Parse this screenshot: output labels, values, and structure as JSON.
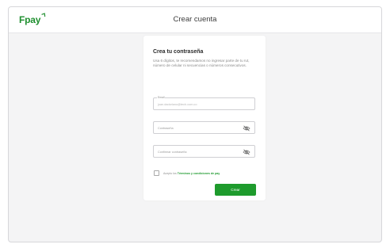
{
  "header": {
    "logo_text": "Fpay",
    "title": "Crear cuenta"
  },
  "form": {
    "title": "Crea tu contraseña",
    "description": "Usa 6 dígitos, te recomendamos no ingresar parte de tu rut, número de celular ni secuencias o números consecutivos.",
    "email": {
      "label": "Email",
      "value": "juan.dadoriano@tech.com.co"
    },
    "password": {
      "placeholder": "Contraseña"
    },
    "confirm_password": {
      "placeholder": "Confirmar contraseña"
    },
    "terms": {
      "prefix": "Acepto los",
      "link": "Términos y condiciones de pay"
    },
    "submit_label": "Crear"
  },
  "colors": {
    "brand_green": "#1e9b2d",
    "background": "#f4f4f5",
    "card": "#ffffff"
  },
  "icons": {
    "logo": "fpay-logo-icon",
    "password_toggle": "eye-off-icon"
  }
}
